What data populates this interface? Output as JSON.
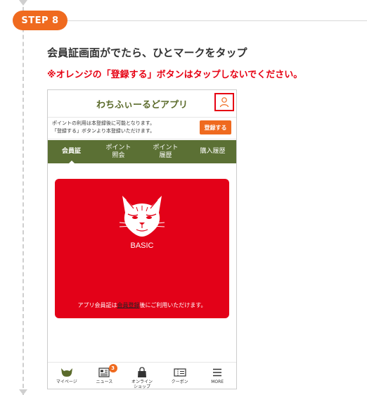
{
  "step": {
    "label": "STEP 8"
  },
  "instruction": "会員証画面がでたら、ひとマークをタップ",
  "warning": "※オレンジの「登録する」ボタンはタップしないでください。",
  "app": {
    "title": "わちふぃーるどアプリ",
    "profile_icon": "person-icon",
    "notice": {
      "line1": "ポイントの利用は本登録後に可能となります。",
      "line2": "「登録する」ボタンより本登録いただけます。",
      "button": "登録する"
    },
    "tabs": [
      {
        "label": "会員証",
        "active": true
      },
      {
        "label": "ポイント\n照会",
        "active": false
      },
      {
        "label": "ポイント\n履歴",
        "active": false
      },
      {
        "label": "購入履歴",
        "active": false
      }
    ],
    "card": {
      "level": "BASIC",
      "note_before": "アプリ会員証は",
      "note_link": "会員登録",
      "note_after": "後にご利用いただけます。",
      "color": "#e30118"
    },
    "bottom_nav": [
      {
        "label": "マイページ",
        "icon": "cat-icon"
      },
      {
        "label": "ニュース",
        "icon": "news-icon",
        "badge": "3"
      },
      {
        "label": "オンライン\nショップ",
        "icon": "bag-icon"
      },
      {
        "label": "クーポン",
        "icon": "coupon-icon"
      },
      {
        "label": "MORE",
        "icon": "menu-icon"
      }
    ]
  },
  "colors": {
    "accent": "#ef6a1f",
    "highlight": "#e60012",
    "brand_green": "#5b7034"
  }
}
